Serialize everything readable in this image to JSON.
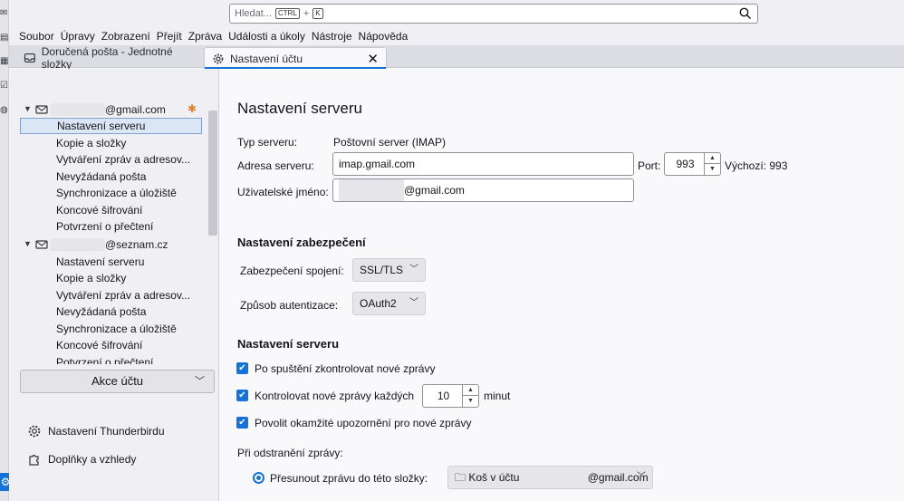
{
  "search": {
    "placeholder": "Hledat...",
    "key1": "CTRL",
    "plus": "+",
    "key2": "K"
  },
  "menu": [
    "Soubor",
    "Úpravy",
    "Zobrazení",
    "Přejít",
    "Zpráva",
    "Události a úkoly",
    "Nástroje",
    "Nápověda"
  ],
  "tabs": [
    {
      "label": "Doručená pošta - Jednotné složky"
    },
    {
      "label": "Nastavení účtu"
    }
  ],
  "tree": {
    "account1": {
      "name_suffix": "@gmail.com"
    },
    "account2": {
      "name_suffix": "@seznam.cz"
    },
    "items1": [
      "Nastavení serveru",
      "Kopie a složky",
      "Vytváření zpráv a adresov...",
      "Nevyžádaná pošta",
      "Synchronizace a úložiště",
      "Koncové šifrování",
      "Potvrzení o přečtení"
    ],
    "items2": [
      "Nastavení serveru",
      "Kopie a složky",
      "Vytváření zpráv a adresov...",
      "Nevyžádaná pošta",
      "Synchronizace a úložiště",
      "Koncové šifrování",
      "Potvrzení o přečtení"
    ]
  },
  "account_actions": "Akce účtu",
  "bottom_links": {
    "settings": "Nastavení Thunderbirdu",
    "addons": "Doplňky a vzhledy"
  },
  "main": {
    "title": "Nastavení serveru",
    "server_type_label": "Typ serveru:",
    "server_type_value": "Poštovní server (IMAP)",
    "server_address_label": "Adresa serveru:",
    "server_address_value": "imap.gmail.com",
    "port_label": "Port:",
    "port_value": "993",
    "default_port": "Výchozí: 993",
    "username_label": "Uživatelské jméno:",
    "username_suffix": "@gmail.com",
    "security_heading": "Nastavení zabezpečení",
    "conn_security_label": "Zabezpečení spojení:",
    "conn_security_value": "SSL/TLS",
    "auth_label": "Způsob autentizace:",
    "auth_value": "OAuth2",
    "server_heading": "Nastavení serveru",
    "check_startup": "Po spuštění zkontrolovat nové zprávy",
    "check_every": "Kontrolovat nové zprávy každých",
    "check_every_value": "10",
    "minutes": "minut",
    "idle": "Povolit okamžité upozornění pro nové zprávy",
    "on_delete_label": "Při odstranění zprávy:",
    "move_to_folder": "Přesunout zprávu do této složky:",
    "trash_prefix": "Koš v účtu",
    "trash_suffix": "@gmail.com"
  },
  "colors": {
    "accent": "#1373d9",
    "star": "#e8812b"
  }
}
